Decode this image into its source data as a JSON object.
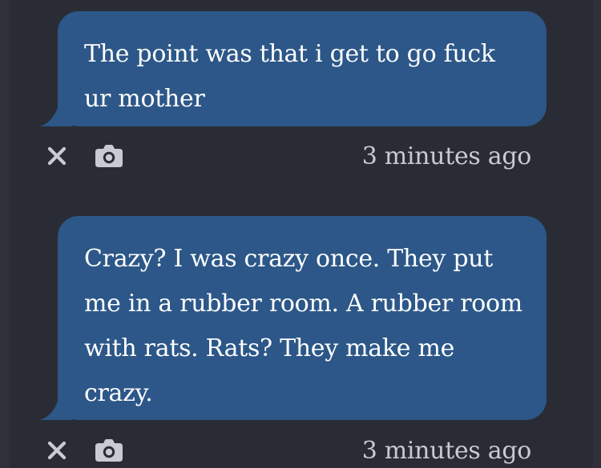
{
  "messages": [
    {
      "text": "The point was that i get to go fuck ur mother",
      "timestamp": "3 minutes ago"
    },
    {
      "text": "Crazy? I was crazy once. They put me in a rubber room. A rubber room with rats. Rats? They make me crazy.",
      "timestamp": "3 minutes ago"
    }
  ],
  "colors": {
    "background": "#2a2c35",
    "bubble": "#2c5788",
    "text": "#ffffff",
    "meta": "#c9cbd2"
  },
  "icons": {
    "delete": "close-icon",
    "screenshot": "camera-icon"
  }
}
